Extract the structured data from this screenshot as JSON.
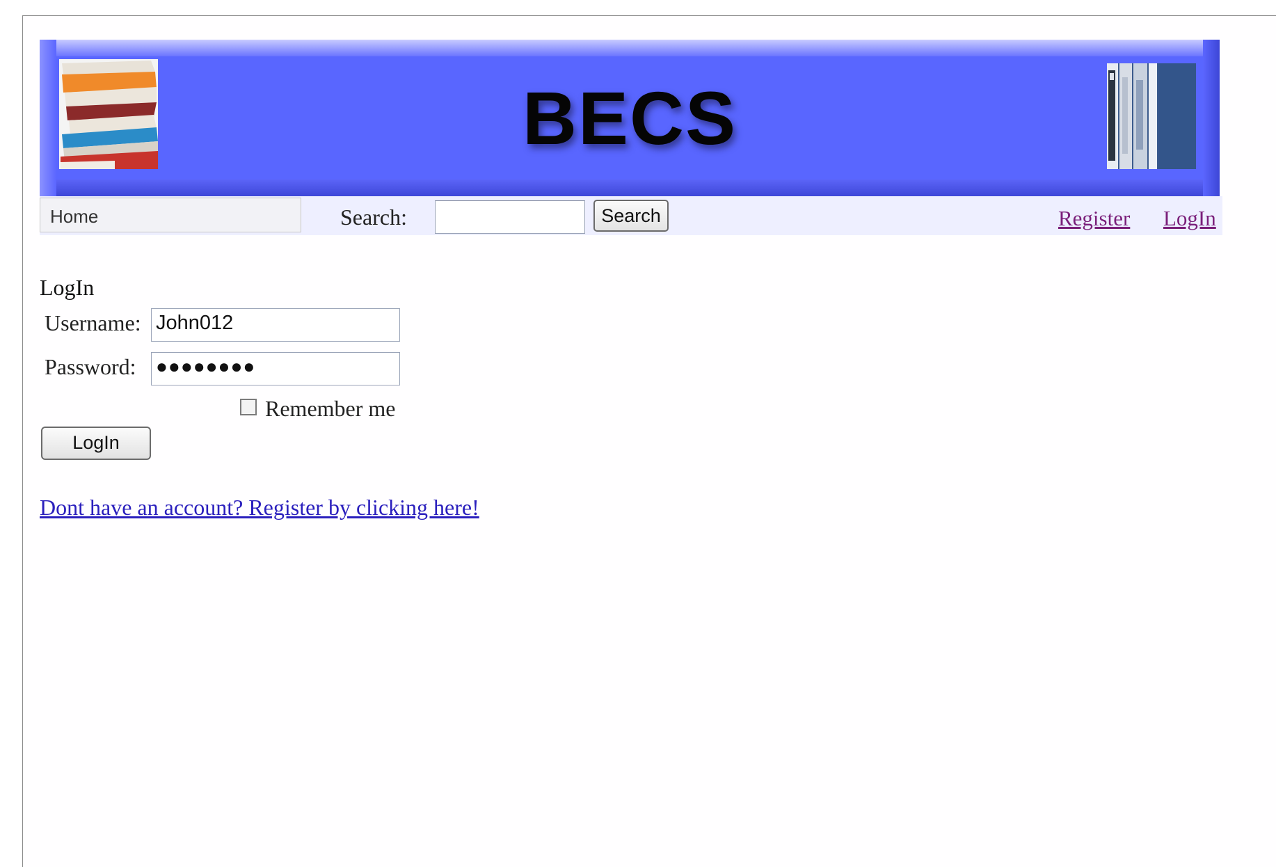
{
  "banner": {
    "title": "BECS",
    "left_image": "books-stack-image",
    "right_image": "bookshelf-image",
    "color": "#5966ff"
  },
  "navbar": {
    "home_label": "Home",
    "search_label": "Search:",
    "search_value": "",
    "search_button": "Search",
    "register_link": "Register",
    "login_link": "LogIn"
  },
  "login_form": {
    "title": "LogIn",
    "username_label": "Username:",
    "username_value": "John012",
    "password_label": "Password:",
    "password_value": "●●●●●●●●",
    "remember_label": "Remember me",
    "remember_checked": false,
    "submit_label": "LogIn",
    "register_prompt": "Dont have an account? Register by clicking here!"
  },
  "colors": {
    "visited_link": "#7a1f7a",
    "link": "#2a1fbd",
    "navbar_bg": "#eeefff"
  }
}
